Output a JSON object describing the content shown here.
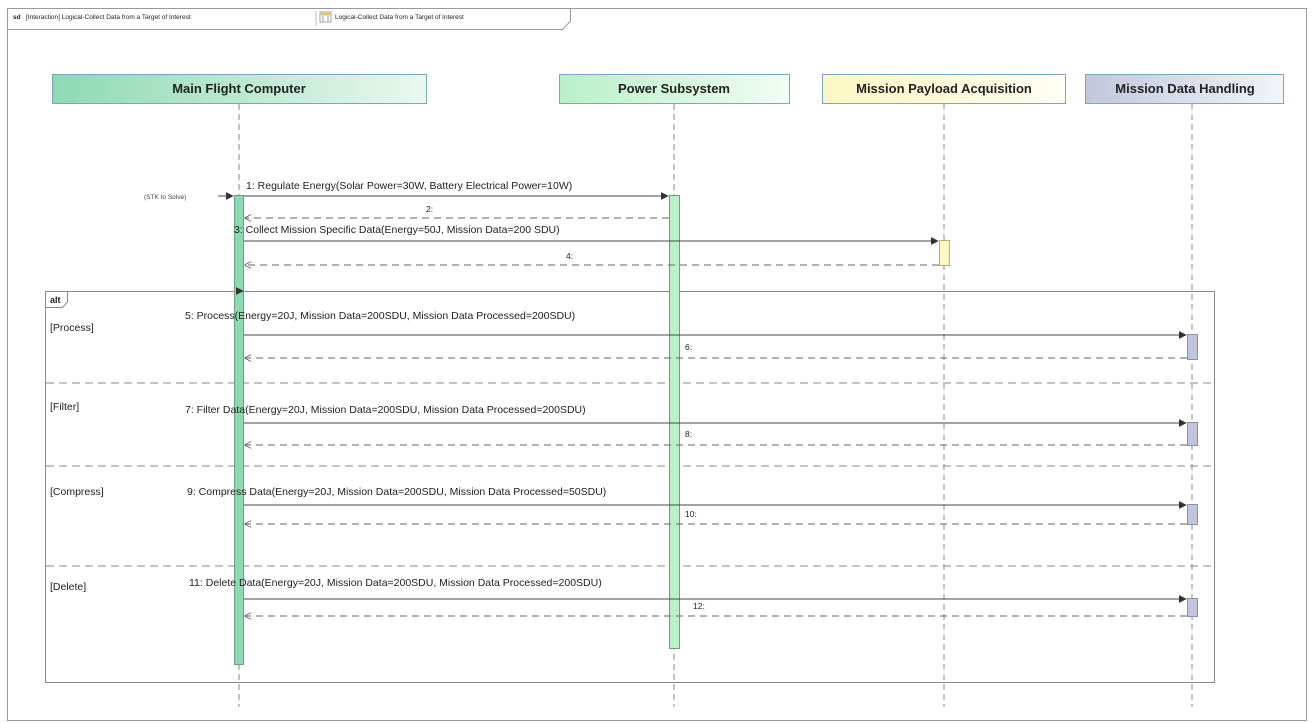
{
  "frame": {
    "kind": "sd",
    "title": "[Interaction] Logical-Collect Data from a Target of Interest",
    "diagram_name": "Logical-Collect Data from a Target of Interest"
  },
  "lifelines": [
    {
      "id": "mfc",
      "name": "Main Flight Computer",
      "fill": "#8ed9b4"
    },
    {
      "id": "pwr",
      "name": "Power Subsystem",
      "fill": "#b9f0c8"
    },
    {
      "id": "mpa",
      "name": "Mission Payload Acquisition",
      "fill": "#fbf7c2"
    },
    {
      "id": "mdh",
      "name": "Mission Data Handling",
      "fill": "#c2c6dc"
    }
  ],
  "gate_label": "(STK to Solve)",
  "messages": [
    {
      "label": "1: Regulate Energy(Solar Power=30W, Battery Electrical Power=10W)",
      "from": "mfc",
      "to": "pwr",
      "kind": "sync"
    },
    {
      "label": "2:",
      "from": "pwr",
      "to": "mfc",
      "kind": "reply"
    },
    {
      "label": "3: Collect Mission Specific Data(Energy=50J, Mission Data=200 SDU)",
      "from": "mfc",
      "to": "mpa",
      "kind": "sync"
    },
    {
      "label": "4:",
      "from": "mpa",
      "to": "mfc",
      "kind": "reply"
    }
  ],
  "alt": {
    "label": "alt",
    "operands": [
      {
        "guard": "[Process]",
        "call": "5: Process(Energy=20J, Mission Data=200SDU, Mission Data Processed=200SDU)",
        "reply": "6:"
      },
      {
        "guard": "[Filter]",
        "call": "7: Filter Data(Energy=20J, Mission Data=200SDU, Mission Data Processed=200SDU)",
        "reply": "8:"
      },
      {
        "guard": "[Compress]",
        "call": "9: Compress Data(Energy=20J, Mission Data=200SDU, Mission Data Processed=50SDU)",
        "reply": "10:"
      },
      {
        "guard": "[Delete]",
        "call": "11: Delete Data(Energy=20J, Mission Data=200SDU, Mission Data Processed=200SDU)",
        "reply": "12:"
      }
    ]
  },
  "colors": {
    "line": "#555555",
    "activation": "#b9f0c8",
    "activation_mfc": "#8ed9b4",
    "activation_mpa": "#fbf7c2",
    "activation_mdh": "#c2c6dc"
  }
}
